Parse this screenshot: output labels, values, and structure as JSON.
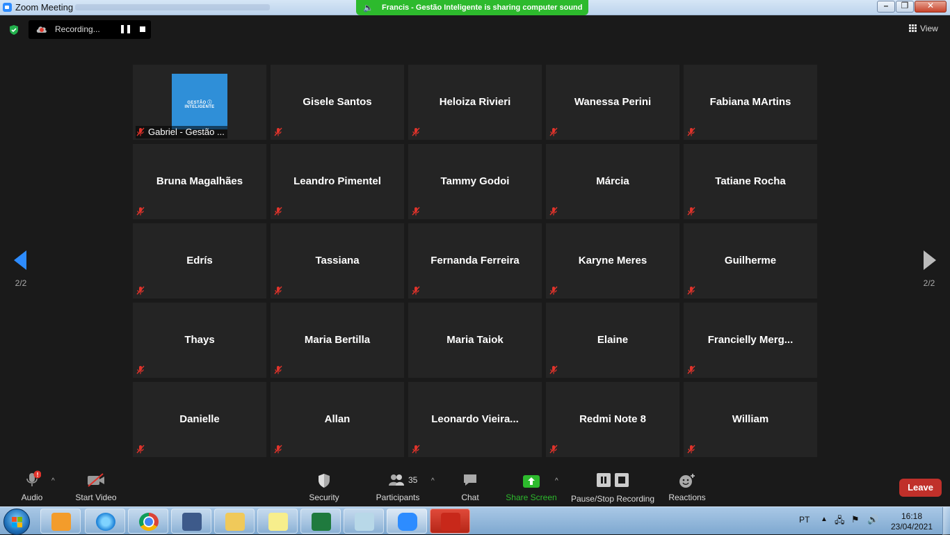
{
  "window": {
    "title": "Zoom Meeting"
  },
  "banner": {
    "text": "Francis - Gestão Inteligente is sharing computer sound"
  },
  "recording": {
    "label": "Recording..."
  },
  "view": {
    "label": "View"
  },
  "pager": {
    "left_page": "2/2",
    "right_page": "2/2"
  },
  "participants": [
    {
      "name": "Gabriel - Gestão ...",
      "has_logo": true,
      "logo_text": "GESTÃO ⓘ INTELIGENTE",
      "muted": true
    },
    {
      "name": "Gisele Santos",
      "muted": true
    },
    {
      "name": "Heloiza Rivieri",
      "muted": true
    },
    {
      "name": "Wanessa Perini",
      "muted": true
    },
    {
      "name": "Fabiana MArtins",
      "muted": true
    },
    {
      "name": "Bruna Magalhães",
      "muted": true
    },
    {
      "name": "Leandro Pimentel",
      "muted": true
    },
    {
      "name": "Tammy Godoi",
      "muted": true
    },
    {
      "name": "Márcia",
      "muted": true
    },
    {
      "name": "Tatiane Rocha",
      "muted": true
    },
    {
      "name": "Edrís",
      "muted": true
    },
    {
      "name": "Tassiana",
      "muted": true
    },
    {
      "name": "Fernanda Ferreira",
      "muted": true
    },
    {
      "name": "Karyne Meres",
      "muted": true
    },
    {
      "name": "Guilherme",
      "muted": true
    },
    {
      "name": "Thays",
      "muted": true
    },
    {
      "name": "Maria Bertilla",
      "muted": true
    },
    {
      "name": "Maria Taiok",
      "muted": false
    },
    {
      "name": "Elaine",
      "muted": true
    },
    {
      "name": "Francielly  Merg...",
      "muted": true
    },
    {
      "name": "Danielle",
      "muted": true
    },
    {
      "name": "Allan",
      "muted": true
    },
    {
      "name": "Leonardo  Vieira...",
      "muted": true
    },
    {
      "name": "Redmi Note 8",
      "muted": true
    },
    {
      "name": "William",
      "muted": true
    }
  ],
  "toolbar": {
    "audio": "Audio",
    "audio_badge": "!",
    "start_video": "Start Video",
    "security": "Security",
    "participants": "Participants",
    "participants_count": "35",
    "chat": "Chat",
    "share_screen": "Share Screen",
    "pause_stop_recording": "Pause/Stop Recording",
    "reactions": "Reactions",
    "leave": "Leave",
    "share_color": "#2dba2d",
    "leave_color": "#c0302a"
  },
  "taskbar": {
    "language": "PT",
    "time": "16:18",
    "date": "23/04/2021",
    "apps": [
      "start-menu",
      "media-player",
      "internet-explorer",
      "chrome",
      "remote-desktop",
      "file-explorer",
      "sticky-notes",
      "excel",
      "notepad",
      "zoom",
      "acrobat"
    ]
  }
}
